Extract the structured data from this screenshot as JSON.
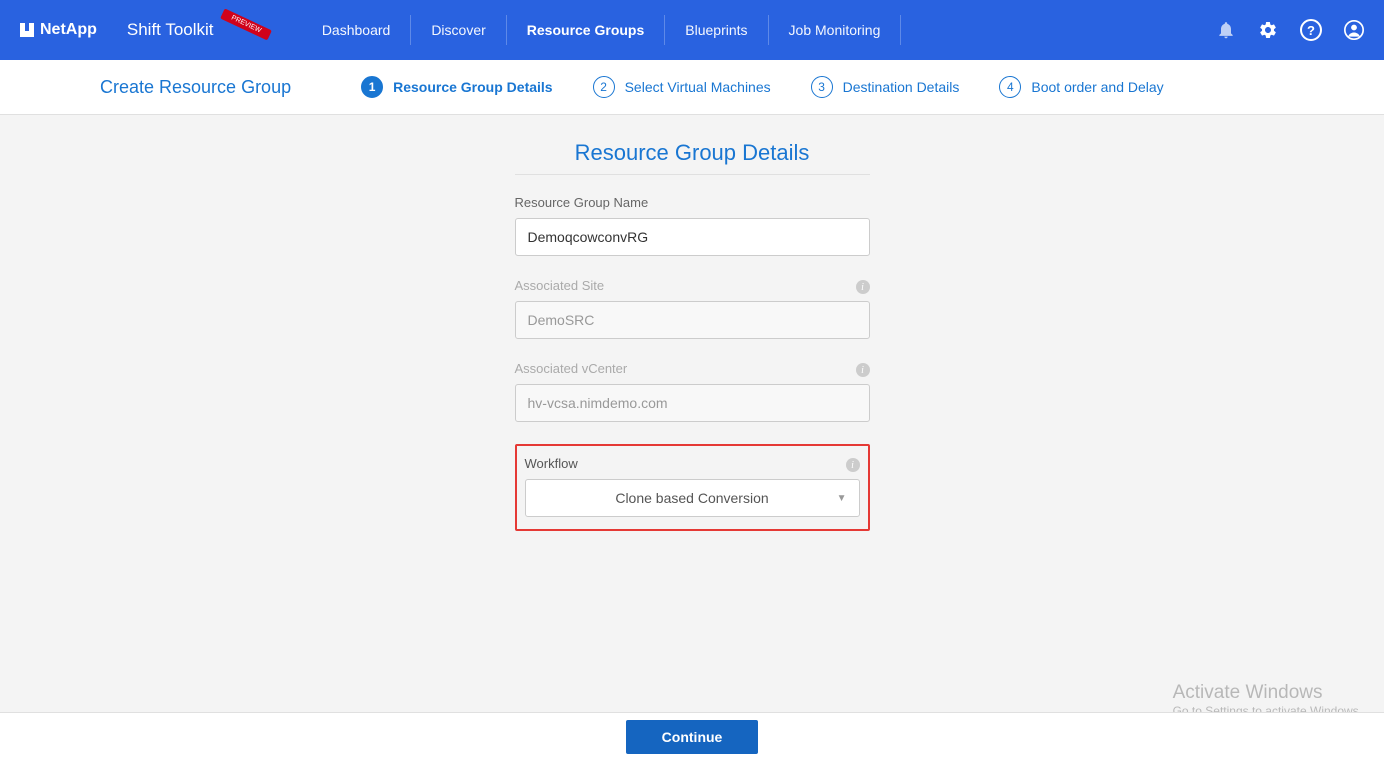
{
  "brand": {
    "company": "NetApp",
    "product": "Shift Toolkit",
    "badge": "PREVIEW"
  },
  "nav": {
    "items": [
      {
        "label": "Dashboard"
      },
      {
        "label": "Discover"
      },
      {
        "label": "Resource Groups"
      },
      {
        "label": "Blueprints"
      },
      {
        "label": "Job Monitoring"
      }
    ]
  },
  "subheader": {
    "title": "Create Resource Group",
    "steps": [
      {
        "num": "1",
        "label": "Resource Group Details"
      },
      {
        "num": "2",
        "label": "Select Virtual Machines"
      },
      {
        "num": "3",
        "label": "Destination Details"
      },
      {
        "num": "4",
        "label": "Boot order and Delay"
      }
    ]
  },
  "form": {
    "heading": "Resource Group Details",
    "name_label": "Resource Group Name",
    "name_value": "DemoqcowconvRG",
    "site_label": "Associated Site",
    "site_value": "DemoSRC",
    "vcenter_label": "Associated vCenter",
    "vcenter_value": "hv-vcsa.nimdemo.com",
    "workflow_label": "Workflow",
    "workflow_value": "Clone based Conversion"
  },
  "footer": {
    "continue": "Continue"
  },
  "watermark": {
    "line1": "Activate Windows",
    "line2": "Go to Settings to activate Windows."
  }
}
